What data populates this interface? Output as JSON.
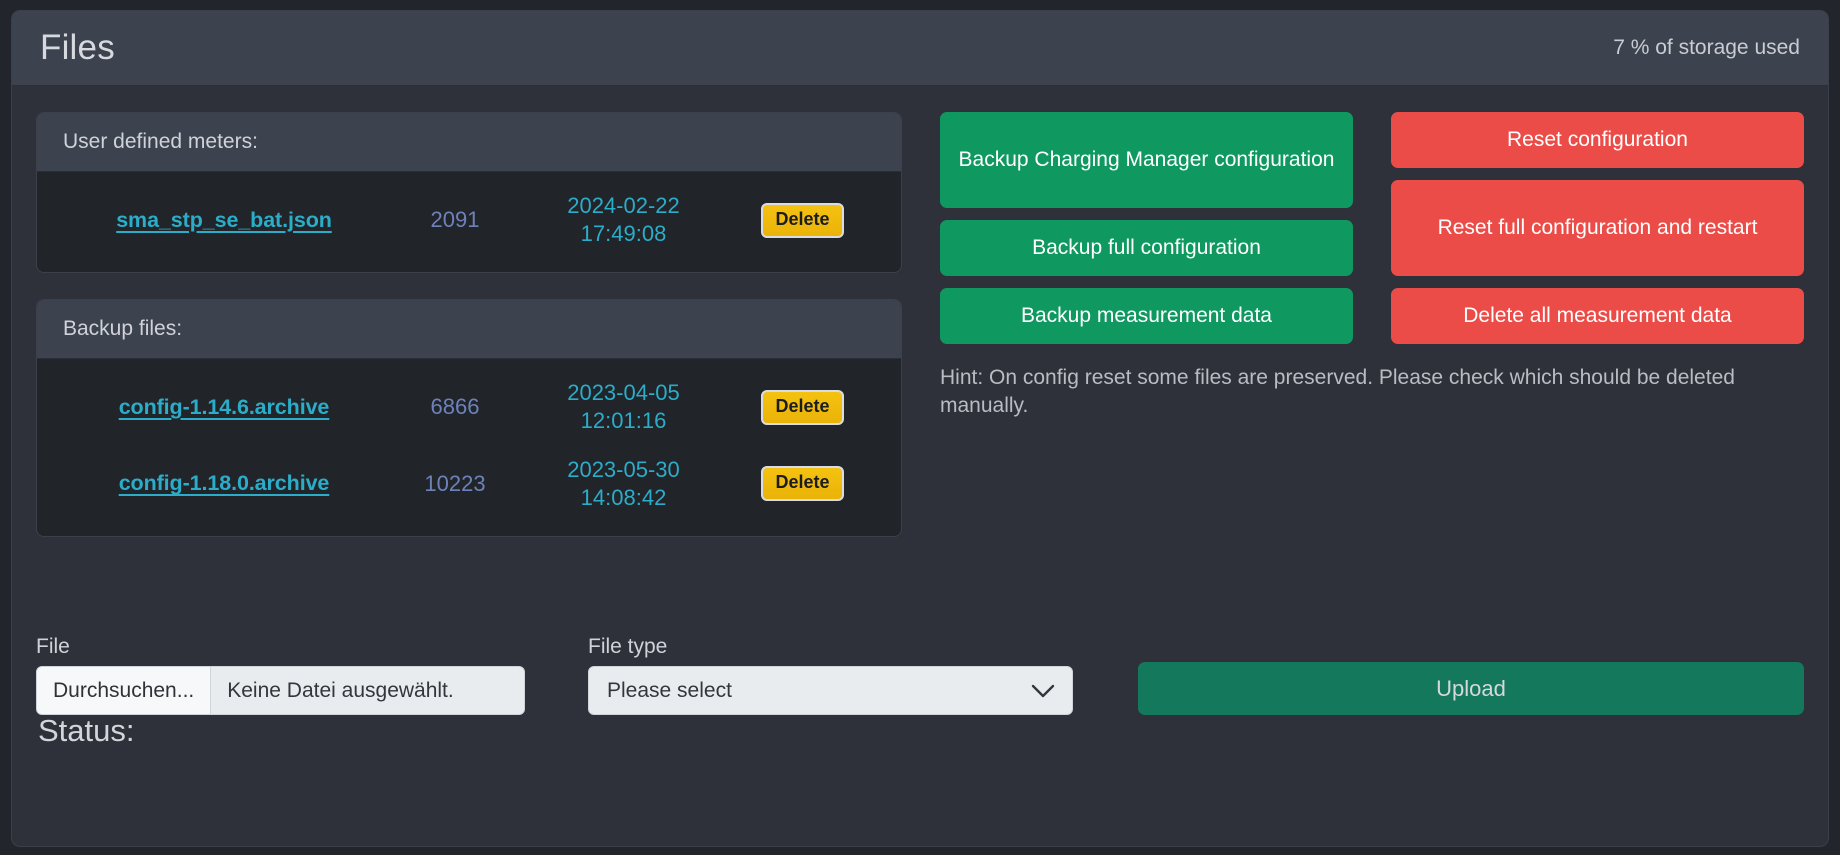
{
  "header": {
    "title": "Files",
    "storage_used": "7 % of storage used"
  },
  "panels": [
    {
      "name": "user-defined-meters",
      "heading": "User defined meters:",
      "rows": [
        {
          "filename": "sma_stp_se_bat.json",
          "size": "2091",
          "date": "2024-02-22",
          "time": "17:49:08",
          "delete_label": "Delete"
        }
      ]
    },
    {
      "name": "backup-files",
      "heading": "Backup files:",
      "rows": [
        {
          "filename": "config-1.14.6.archive",
          "size": "6866",
          "date": "2023-04-05",
          "time": "12:01:16",
          "delete_label": "Delete"
        },
        {
          "filename": "config-1.18.0.archive",
          "size": "10223",
          "date": "2023-05-30",
          "time": "14:08:42",
          "delete_label": "Delete"
        }
      ]
    }
  ],
  "actions": {
    "backup": [
      {
        "label": "Backup Charging Manager configuration",
        "tall": true
      },
      {
        "label": "Backup full configuration",
        "tall": false
      },
      {
        "label": "Backup measurement data",
        "tall": false
      }
    ],
    "danger": [
      {
        "label": "Reset configuration",
        "tall": false
      },
      {
        "label": "Reset full configuration and restart",
        "tall": true
      },
      {
        "label": "Delete all measurement data",
        "tall": false
      }
    ],
    "hint": "Hint: On config reset some files are preserved. Please check which should be deleted manually."
  },
  "upload_form": {
    "file_label": "File",
    "file_browse_label": "Durchsuchen...",
    "file_value": "Keine Datei ausgewählt.",
    "type_label": "File type",
    "type_value": "Please select",
    "upload_label": "Upload"
  },
  "status": {
    "label": "Status:",
    "value": ""
  },
  "colors": {
    "accent_link": "#2badc9",
    "success": "#0f9960",
    "danger": "#ec4c48",
    "warning": "#f0b90b",
    "panel_header": "#3d424f",
    "panel_body": "#212429",
    "card": "#2e3139"
  }
}
